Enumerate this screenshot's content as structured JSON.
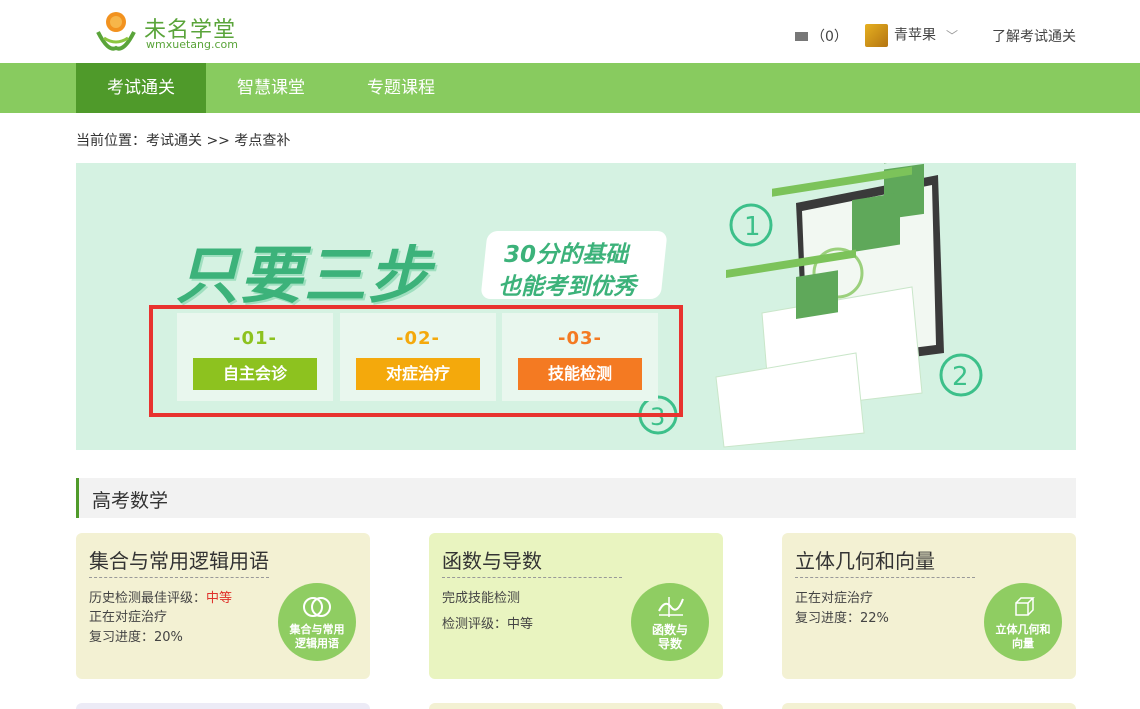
{
  "logo": {
    "title": "未名学堂",
    "domain": "wmxuetang.com"
  },
  "header": {
    "mail_count": "（0）",
    "username": "青苹果",
    "learn_link": "了解考试通关"
  },
  "nav": {
    "tabs": [
      {
        "label": "考试通关",
        "active": true
      },
      {
        "label": "智慧课堂",
        "active": false
      },
      {
        "label": "专题课程",
        "active": false
      }
    ]
  },
  "breadcrumb": "当前位置：考试通关 >> 考点查补",
  "banner": {
    "slogan_main": "只要三步",
    "slogan_sub_1": "30分的基础",
    "slogan_sub_2": "也能考到优秀",
    "steps": [
      {
        "num": "-01-",
        "label": "自主会诊",
        "color": "#8dc21f"
      },
      {
        "num": "-02-",
        "label": "对症治疗",
        "color": "#f4a90c"
      },
      {
        "num": "-03-",
        "label": "技能检测",
        "color": "#f47a22"
      }
    ]
  },
  "section": {
    "title": "高考数学"
  },
  "cards": [
    {
      "title": "集合与常用逻辑用语",
      "lines": [
        {
          "text": "历史检测最佳评级：",
          "highlight": "中等"
        },
        {
          "text": "正在对症治疗",
          "highlight": ""
        },
        {
          "text": "复习进度：20%",
          "highlight": ""
        }
      ],
      "circle_label": "集合与常用逻辑用语",
      "icon": "venn-diagram-icon",
      "bg": "#f3f1d3"
    },
    {
      "title": "函数与导数",
      "lines": [
        {
          "text": "完成技能检测",
          "highlight": ""
        },
        {
          "text": "检测评级：中等",
          "highlight": ""
        }
      ],
      "circle_label": "函数与导数",
      "icon": "function-graph-icon",
      "bg": "#e9f4c0"
    },
    {
      "title": "立体几何和向量",
      "lines": [
        {
          "text": "正在对症治疗",
          "highlight": ""
        },
        {
          "text": "复习进度：22%",
          "highlight": ""
        }
      ],
      "circle_label": "立体几何和向量",
      "icon": "cube-icon",
      "bg": "#f3f1d3"
    }
  ]
}
